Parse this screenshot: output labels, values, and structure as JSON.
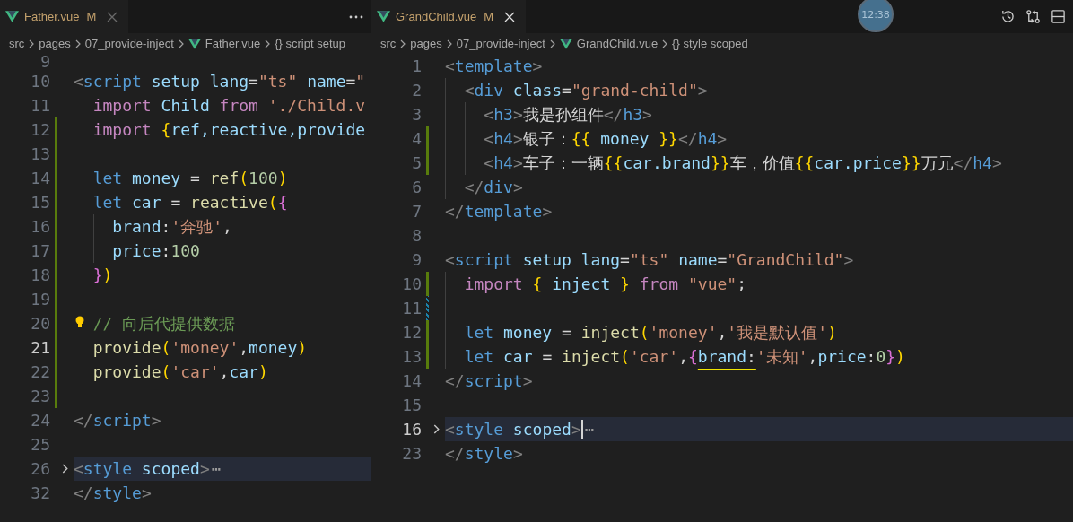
{
  "editors": [
    {
      "tab": {
        "label": "Father.vue",
        "status": "M",
        "selected": true
      },
      "focused": false,
      "breadcrumb": [
        {
          "kind": "folder",
          "label": "src"
        },
        {
          "kind": "folder",
          "label": "pages"
        },
        {
          "kind": "folder",
          "label": "07_provide-inject"
        },
        {
          "kind": "file",
          "label": "Father.vue"
        },
        {
          "kind": "symbol",
          "label": "{} script setup"
        }
      ],
      "lines": [
        {
          "number": "9"
        },
        {
          "number": "10",
          "tokens": [
            {
              "kind": "punct",
              "text": "<"
            },
            {
              "kind": "tag",
              "text": "script"
            },
            {
              "kind": "attr",
              "text": " setup"
            },
            {
              "kind": "attr",
              "text": " lang"
            },
            {
              "kind": "plain",
              "text": "="
            },
            {
              "kind": "string",
              "text": "\"ts\""
            },
            {
              "kind": "attr",
              "text": " name"
            },
            {
              "kind": "plain",
              "text": "="
            },
            {
              "kind": "string",
              "text": "\""
            }
          ],
          "children": [
            {
              "number": "11",
              "tokens": [
                {
                  "kind": "keyword",
                  "text": "import"
                },
                {
                  "kind": "var",
                  "text": " Child"
                },
                {
                  "kind": "keyword",
                  "text": " from"
                },
                {
                  "kind": "string",
                  "text": " './Child.v"
                }
              ]
            },
            {
              "number": "12",
              "modified": true,
              "tokens": [
                {
                  "kind": "keyword",
                  "text": "import"
                },
                {
                  "kind": "brace",
                  "text": " {"
                },
                {
                  "kind": "var",
                  "text": "ref,reactive,provide"
                }
              ]
            },
            {
              "number": "13",
              "modified": true
            },
            {
              "number": "14",
              "modified": true,
              "tokens": [
                {
                  "kind": "decl",
                  "text": "let"
                },
                {
                  "kind": "var",
                  "text": " money"
                },
                {
                  "kind": "plain",
                  "text": " ="
                },
                {
                  "kind": "func",
                  "text": " ref"
                },
                {
                  "kind": "brace",
                  "text": "("
                },
                {
                  "kind": "number",
                  "text": "100"
                },
                {
                  "kind": "brace",
                  "text": ")"
                }
              ]
            },
            {
              "number": "15",
              "modified": true,
              "tokens": [
                {
                  "kind": "decl",
                  "text": "let"
                },
                {
                  "kind": "var",
                  "text": " car"
                },
                {
                  "kind": "plain",
                  "text": " ="
                },
                {
                  "kind": "func",
                  "text": " reactive"
                },
                {
                  "kind": "brace",
                  "text": "("
                },
                {
                  "kind": "brace2",
                  "text": "{"
                }
              ],
              "children": [
                {
                  "number": "16",
                  "modified": true,
                  "tokens": [
                    {
                      "kind": "var",
                      "text": "brand"
                    },
                    {
                      "kind": "plain",
                      "text": ":"
                    },
                    {
                      "kind": "string",
                      "text": "'奔驰'"
                    },
                    {
                      "kind": "plain",
                      "text": ","
                    }
                  ]
                },
                {
                  "number": "17",
                  "modified": true,
                  "tokens": [
                    {
                      "kind": "var",
                      "text": "price"
                    },
                    {
                      "kind": "plain",
                      "text": ":"
                    },
                    {
                      "kind": "number",
                      "text": "100"
                    }
                  ]
                }
              ]
            },
            {
              "number": "18",
              "modified": true,
              "tokens": [
                {
                  "kind": "brace2",
                  "text": "}"
                },
                {
                  "kind": "brace",
                  "text": ")"
                }
              ]
            },
            {
              "number": "19",
              "modified": true
            },
            {
              "number": "20",
              "modified": true,
              "lightbulb": true,
              "tokens": [
                {
                  "kind": "comment",
                  "text": "// 向后代提供数据"
                }
              ]
            },
            {
              "number": "21",
              "modified": true,
              "current": true,
              "tokens": [
                {
                  "kind": "func",
                  "text": "provide"
                },
                {
                  "kind": "brace",
                  "text": "("
                },
                {
                  "kind": "string",
                  "text": "'money'"
                },
                {
                  "kind": "plain",
                  "text": ","
                },
                {
                  "kind": "var",
                  "text": "money"
                },
                {
                  "kind": "brace",
                  "text": ")"
                }
              ]
            },
            {
              "number": "22",
              "modified": true,
              "tokens": [
                {
                  "kind": "func",
                  "text": "provide"
                },
                {
                  "kind": "brace",
                  "text": "("
                },
                {
                  "kind": "string",
                  "text": "'car'"
                },
                {
                  "kind": "plain",
                  "text": ","
                },
                {
                  "kind": "var",
                  "text": "car"
                },
                {
                  "kind": "brace",
                  "text": ")"
                }
              ]
            },
            {
              "number": "23",
              "modified": true
            }
          ]
        },
        {
          "number": "24",
          "tokens": [
            {
              "kind": "punct",
              "text": "</"
            },
            {
              "kind": "tag",
              "text": "script"
            },
            {
              "kind": "punct",
              "text": ">"
            }
          ]
        },
        {
          "number": "25"
        },
        {
          "number": "26",
          "folded": true,
          "fold_text": "⋯",
          "tokens": [
            {
              "kind": "punct",
              "text": "<"
            },
            {
              "kind": "tag",
              "text": "style"
            },
            {
              "kind": "attr",
              "text": " scoped"
            },
            {
              "kind": "punct",
              "text": ">"
            }
          ]
        },
        {
          "number": "32",
          "tokens": [
            {
              "kind": "punct",
              "text": "</"
            },
            {
              "kind": "tag",
              "text": "style"
            },
            {
              "kind": "punct",
              "text": ">"
            }
          ]
        }
      ]
    },
    {
      "tab": {
        "label": "GrandChild.vue",
        "status": "M",
        "selected": true
      },
      "focused": true,
      "timer": "12:38",
      "breadcrumb": [
        {
          "kind": "folder",
          "label": "src"
        },
        {
          "kind": "folder",
          "label": "pages"
        },
        {
          "kind": "folder",
          "label": "07_provide-inject"
        },
        {
          "kind": "file",
          "label": "GrandChild.vue"
        },
        {
          "kind": "symbol",
          "label": "{} style scoped"
        }
      ],
      "lines": [
        {
          "number": "1",
          "tokens": [
            {
              "kind": "punct",
              "text": "<"
            },
            {
              "kind": "tag",
              "text": "template"
            },
            {
              "kind": "punct",
              "text": ">"
            }
          ],
          "children": [
            {
              "number": "2",
              "tokens": [
                {
                  "kind": "punct",
                  "text": "<"
                },
                {
                  "kind": "tag",
                  "text": "div"
                },
                {
                  "kind": "attr",
                  "text": " class"
                },
                {
                  "kind": "plain",
                  "text": "="
                },
                {
                  "kind": "string",
                  "text": "\""
                },
                {
                  "kind": "link-string",
                  "text": "grand-child"
                },
                {
                  "kind": "string",
                  "text": "\""
                },
                {
                  "kind": "punct",
                  "text": ">"
                }
              ],
              "children": [
                {
                  "number": "3",
                  "tokens": [
                    {
                      "kind": "punct",
                      "text": "<"
                    },
                    {
                      "kind": "tag",
                      "text": "h3"
                    },
                    {
                      "kind": "punct",
                      "text": ">"
                    },
                    {
                      "kind": "plain",
                      "text": "我是孙组件"
                    },
                    {
                      "kind": "punct",
                      "text": "</"
                    },
                    {
                      "kind": "tag",
                      "text": "h3"
                    },
                    {
                      "kind": "punct",
                      "text": ">"
                    }
                  ]
                },
                {
                  "number": "4",
                  "modified": true,
                  "tokens": [
                    {
                      "kind": "punct",
                      "text": "<"
                    },
                    {
                      "kind": "tag",
                      "text": "h4"
                    },
                    {
                      "kind": "punct",
                      "text": ">"
                    },
                    {
                      "kind": "plain",
                      "text": "银子："
                    },
                    {
                      "kind": "brace",
                      "text": "{{"
                    },
                    {
                      "kind": "var",
                      "text": " money "
                    },
                    {
                      "kind": "brace",
                      "text": "}}"
                    },
                    {
                      "kind": "punct",
                      "text": "</"
                    },
                    {
                      "kind": "tag",
                      "text": "h4"
                    },
                    {
                      "kind": "punct",
                      "text": ">"
                    }
                  ]
                },
                {
                  "number": "5",
                  "modified": true,
                  "tokens": [
                    {
                      "kind": "punct",
                      "text": "<"
                    },
                    {
                      "kind": "tag",
                      "text": "h4"
                    },
                    {
                      "kind": "punct",
                      "text": ">"
                    },
                    {
                      "kind": "plain",
                      "text": "车子：一辆"
                    },
                    {
                      "kind": "brace",
                      "text": "{{"
                    },
                    {
                      "kind": "var",
                      "text": "car.brand"
                    },
                    {
                      "kind": "brace",
                      "text": "}}"
                    },
                    {
                      "kind": "plain",
                      "text": "车，价值"
                    },
                    {
                      "kind": "brace",
                      "text": "{{"
                    },
                    {
                      "kind": "var",
                      "text": "car.price"
                    },
                    {
                      "kind": "brace",
                      "text": "}}"
                    },
                    {
                      "kind": "plain",
                      "text": "万元"
                    },
                    {
                      "kind": "punct",
                      "text": "</"
                    },
                    {
                      "kind": "tag",
                      "text": "h4"
                    },
                    {
                      "kind": "punct",
                      "text": ">"
                    }
                  ]
                }
              ]
            },
            {
              "number": "6",
              "tokens": [
                {
                  "kind": "punct",
                  "text": "</"
                },
                {
                  "kind": "tag",
                  "text": "div"
                },
                {
                  "kind": "punct",
                  "text": ">"
                }
              ]
            }
          ]
        },
        {
          "number": "7",
          "tokens": [
            {
              "kind": "punct",
              "text": "</"
            },
            {
              "kind": "tag",
              "text": "template"
            },
            {
              "kind": "punct",
              "text": ">"
            }
          ]
        },
        {
          "number": "8"
        },
        {
          "number": "9",
          "tokens": [
            {
              "kind": "punct",
              "text": "<"
            },
            {
              "kind": "tag",
              "text": "script"
            },
            {
              "kind": "attr",
              "text": " setup"
            },
            {
              "kind": "attr",
              "text": " lang"
            },
            {
              "kind": "plain",
              "text": "="
            },
            {
              "kind": "string",
              "text": "\"ts\""
            },
            {
              "kind": "attr",
              "text": " name"
            },
            {
              "kind": "plain",
              "text": "="
            },
            {
              "kind": "string",
              "text": "\"GrandChild\""
            },
            {
              "kind": "punct",
              "text": ">"
            }
          ],
          "children": [
            {
              "number": "10",
              "modified": true,
              "tokens": [
                {
                  "kind": "keyword",
                  "text": "import"
                },
                {
                  "kind": "brace",
                  "text": " {"
                },
                {
                  "kind": "var",
                  "text": " inject"
                },
                {
                  "kind": "brace",
                  "text": " }"
                },
                {
                  "kind": "keyword",
                  "text": " from"
                },
                {
                  "kind": "string",
                  "text": " \"vue\""
                },
                {
                  "kind": "plain",
                  "text": ";"
                }
              ]
            },
            {
              "number": "11",
              "edited": true
            },
            {
              "number": "12",
              "modified": true,
              "tokens": [
                {
                  "kind": "decl",
                  "text": "let"
                },
                {
                  "kind": "var",
                  "text": " money"
                },
                {
                  "kind": "plain",
                  "text": " ="
                },
                {
                  "kind": "func",
                  "text": " inject"
                },
                {
                  "kind": "brace",
                  "text": "("
                },
                {
                  "kind": "string",
                  "text": "'money'"
                },
                {
                  "kind": "plain",
                  "text": ","
                },
                {
                  "kind": "string",
                  "text": "'我是默认值'"
                },
                {
                  "kind": "brace",
                  "text": ")"
                }
              ]
            },
            {
              "number": "13",
              "modified": true,
              "tokens": [
                {
                  "kind": "decl",
                  "text": "let"
                },
                {
                  "kind": "var",
                  "text": " car"
                },
                {
                  "kind": "plain",
                  "text": " ="
                },
                {
                  "kind": "func",
                  "text": " inject"
                },
                {
                  "kind": "brace",
                  "text": "("
                },
                {
                  "kind": "string",
                  "text": "'car'"
                },
                {
                  "kind": "plain",
                  "text": ","
                },
                {
                  "kind": "brace2",
                  "text": "{"
                },
                {
                  "kind": "var",
                  "text": "brand",
                  "underlined": true
                },
                {
                  "kind": "plain",
                  "text": ":",
                  "underlined": true
                },
                {
                  "kind": "string",
                  "text": "'未知'"
                },
                {
                  "kind": "plain",
                  "text": ","
                },
                {
                  "kind": "var",
                  "text": "price"
                },
                {
                  "kind": "plain",
                  "text": ":"
                },
                {
                  "kind": "number",
                  "text": "0"
                },
                {
                  "kind": "brace2",
                  "text": "}"
                },
                {
                  "kind": "brace",
                  "text": ")"
                }
              ]
            }
          ]
        },
        {
          "number": "14",
          "tokens": [
            {
              "kind": "punct",
              "text": "</"
            },
            {
              "kind": "tag",
              "text": "script"
            },
            {
              "kind": "punct",
              "text": ">"
            }
          ]
        },
        {
          "number": "15"
        },
        {
          "number": "16",
          "folded": true,
          "current": true,
          "cursor": true,
          "fold_text": "⋯",
          "tokens": [
            {
              "kind": "punct",
              "text": "<"
            },
            {
              "kind": "tag",
              "text": "style"
            },
            {
              "kind": "attr",
              "text": " scoped"
            },
            {
              "kind": "punct",
              "text": ">"
            }
          ]
        },
        {
          "number": "23",
          "tokens": [
            {
              "kind": "punct",
              "text": "</"
            },
            {
              "kind": "tag",
              "text": "style"
            },
            {
              "kind": "punct",
              "text": ">"
            }
          ]
        }
      ]
    }
  ]
}
